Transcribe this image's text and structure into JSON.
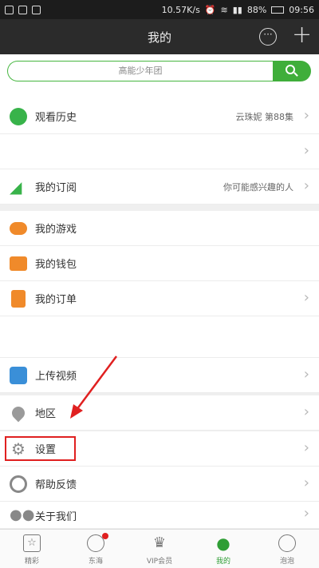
{
  "status": {
    "speed": "10.57K/s",
    "battery": "88%",
    "time": "09:56"
  },
  "header": {
    "title": "我的",
    "more_icon": "more-icon",
    "add_icon": "plus-icon"
  },
  "search": {
    "placeholder": "高能少年团"
  },
  "rows": {
    "history": {
      "label": "观看历史",
      "right": "云珠妮 第88集"
    },
    "subscribe": {
      "label": "我的订阅",
      "right": "你可能感兴趣的人"
    },
    "games": {
      "label": "我的游戏"
    },
    "wallet": {
      "label": "我的钱包"
    },
    "orders": {
      "label": "我的订单"
    },
    "upload": {
      "label": "上传视频"
    },
    "location": {
      "label": "地区"
    },
    "settings": {
      "label": "设置"
    },
    "feedback": {
      "label": "帮助反馈"
    },
    "about": {
      "label": "关于我们"
    }
  },
  "tabs": [
    {
      "label": "精彩"
    },
    {
      "label": "东海"
    },
    {
      "label": "VIP会员"
    },
    {
      "label": "我的"
    },
    {
      "label": "泡泡"
    }
  ],
  "colors": {
    "accent": "#3fae3a",
    "highlight_box": "#e02020"
  }
}
